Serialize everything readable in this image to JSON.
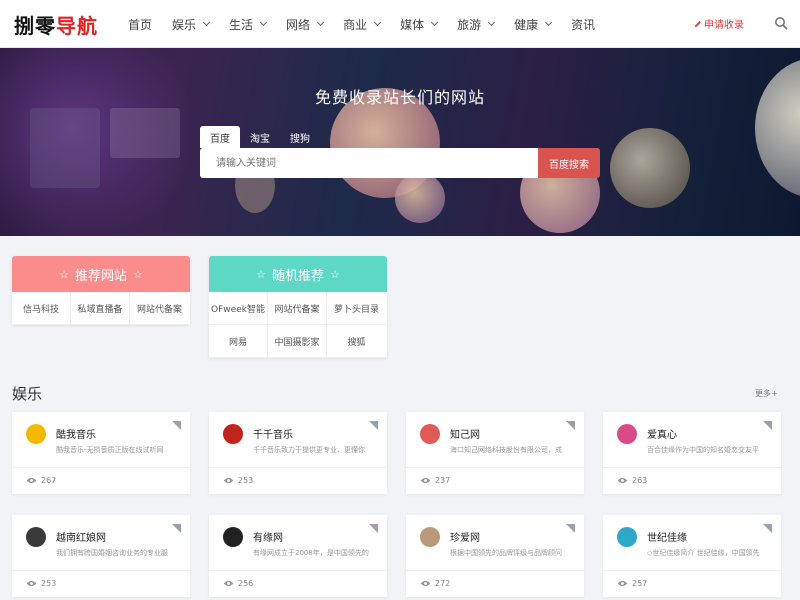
{
  "header": {
    "logo_part1": "捌零",
    "logo_part2": "导航",
    "nav": [
      {
        "label": "首页",
        "dropdown": false
      },
      {
        "label": "娱乐",
        "dropdown": true
      },
      {
        "label": "生活",
        "dropdown": true
      },
      {
        "label": "网络",
        "dropdown": true
      },
      {
        "label": "商业",
        "dropdown": true
      },
      {
        "label": "媒体",
        "dropdown": true
      },
      {
        "label": "旅游",
        "dropdown": true
      },
      {
        "label": "健康",
        "dropdown": true
      },
      {
        "label": "资讯",
        "dropdown": false
      }
    ],
    "apply_label": "申请收录"
  },
  "hero": {
    "title": "免费收录站长们的网站",
    "tabs": [
      "百度",
      "淘宝",
      "搜狗"
    ],
    "active_tab": "百度",
    "search_placeholder": "请输入关键词",
    "search_button": "百度搜索"
  },
  "recommend": {
    "title": "推荐网站",
    "color": "#fb8c8c",
    "items": [
      "信马科技",
      "私域直播备",
      "网站代备案"
    ]
  },
  "random": {
    "title": "随机推荐",
    "color": "#5dd8c6",
    "items": [
      "OFweek智能",
      "网站代备案",
      "萝卜头目录",
      "网易",
      "中国摄影家",
      "搜狐"
    ]
  },
  "section": {
    "title": "娱乐",
    "more": "更多+"
  },
  "sites": [
    {
      "name": "酷我音乐",
      "desc": "酷我音乐-无损音质正版在线试听网",
      "views": "267",
      "icon": "kuwo-music-icon",
      "icon_color": "#f5b800"
    },
    {
      "name": "千千音乐",
      "desc": "千千音乐致力于提供更专业、更懂你",
      "views": "253",
      "icon": "qianqian-music-icon",
      "icon_color": "#c0241c"
    },
    {
      "name": "知己网",
      "desc": "海口知己网络科技股份有限公司，成",
      "views": "237",
      "icon": "zhiji-icon",
      "icon_color": "#e05a5a"
    },
    {
      "name": "爱真心",
      "desc": "百合佳缘作为中国的知名婚恋交友平",
      "views": "263",
      "icon": "aizhenxin-icon",
      "icon_color": "#d94a8a"
    },
    {
      "name": "越南红娘网",
      "desc": "我们拥有跨国婚姻咨询业务的专业服",
      "views": "253",
      "icon": "vietnam-matchmaker-icon",
      "icon_color": "#3a3a3a"
    },
    {
      "name": "有缘网",
      "desc": "有缘网成立于2008年，是中国领先的",
      "views": "256",
      "icon": "youyuan-icon",
      "icon_color": "#222222"
    },
    {
      "name": "珍爱网",
      "desc": "根据中国领先的品牌评级与品牌顾问",
      "views": "272",
      "icon": "zhenai-icon",
      "icon_color": "#b89a7a"
    },
    {
      "name": "世纪佳缘",
      "desc": "◇世纪佳缘简介 世纪佳缘，中国领先",
      "views": "257",
      "icon": "jiayuan-icon",
      "icon_color": "#2fa8c9"
    }
  ]
}
